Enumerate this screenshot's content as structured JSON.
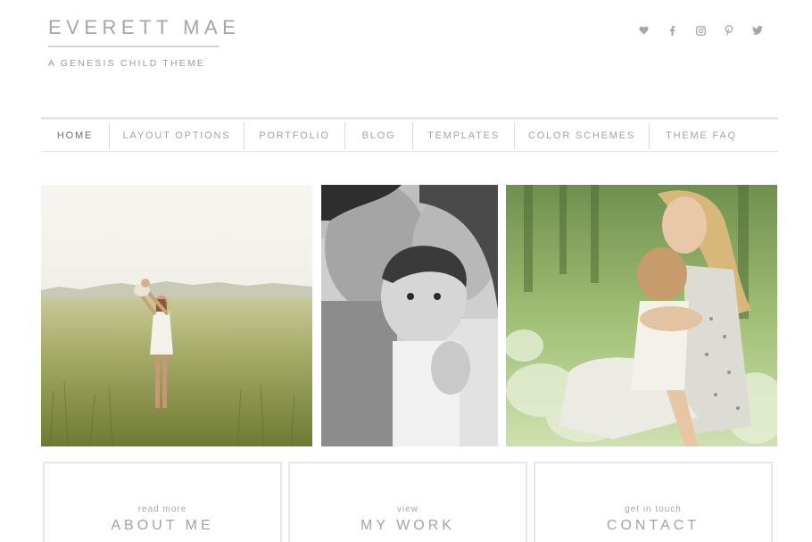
{
  "header": {
    "title": "EVERETT MAE",
    "description": "A GENESIS CHILD THEME"
  },
  "social": [
    "heart-icon",
    "facebook-icon",
    "instagram-icon",
    "pinterest-icon",
    "twitter-icon"
  ],
  "nav": {
    "items": [
      {
        "label": "HOME",
        "active": true
      },
      {
        "label": "LAYOUT OPTIONS"
      },
      {
        "label": "PORTFOLIO"
      },
      {
        "label": "BLOG"
      },
      {
        "label": "TEMPLATES"
      },
      {
        "label": "COLOR SCHEMES"
      },
      {
        "label": "THEME FAQ"
      }
    ]
  },
  "photos": [
    {
      "subject": "mother lifting baby in a grassy field"
    },
    {
      "subject": "black and white portrait of parents with baby"
    },
    {
      "subject": "mother hugging child among ferns"
    }
  ],
  "boxes": [
    {
      "small": "read more",
      "big": "ABOUT ME"
    },
    {
      "small": "view",
      "big": "MY WORK"
    },
    {
      "small": "get in touch",
      "big": "CONTACT"
    }
  ],
  "colors": {
    "text": "#a6a6a6",
    "nav_active": "#6e6e6e",
    "border": "#e6e6e6"
  }
}
